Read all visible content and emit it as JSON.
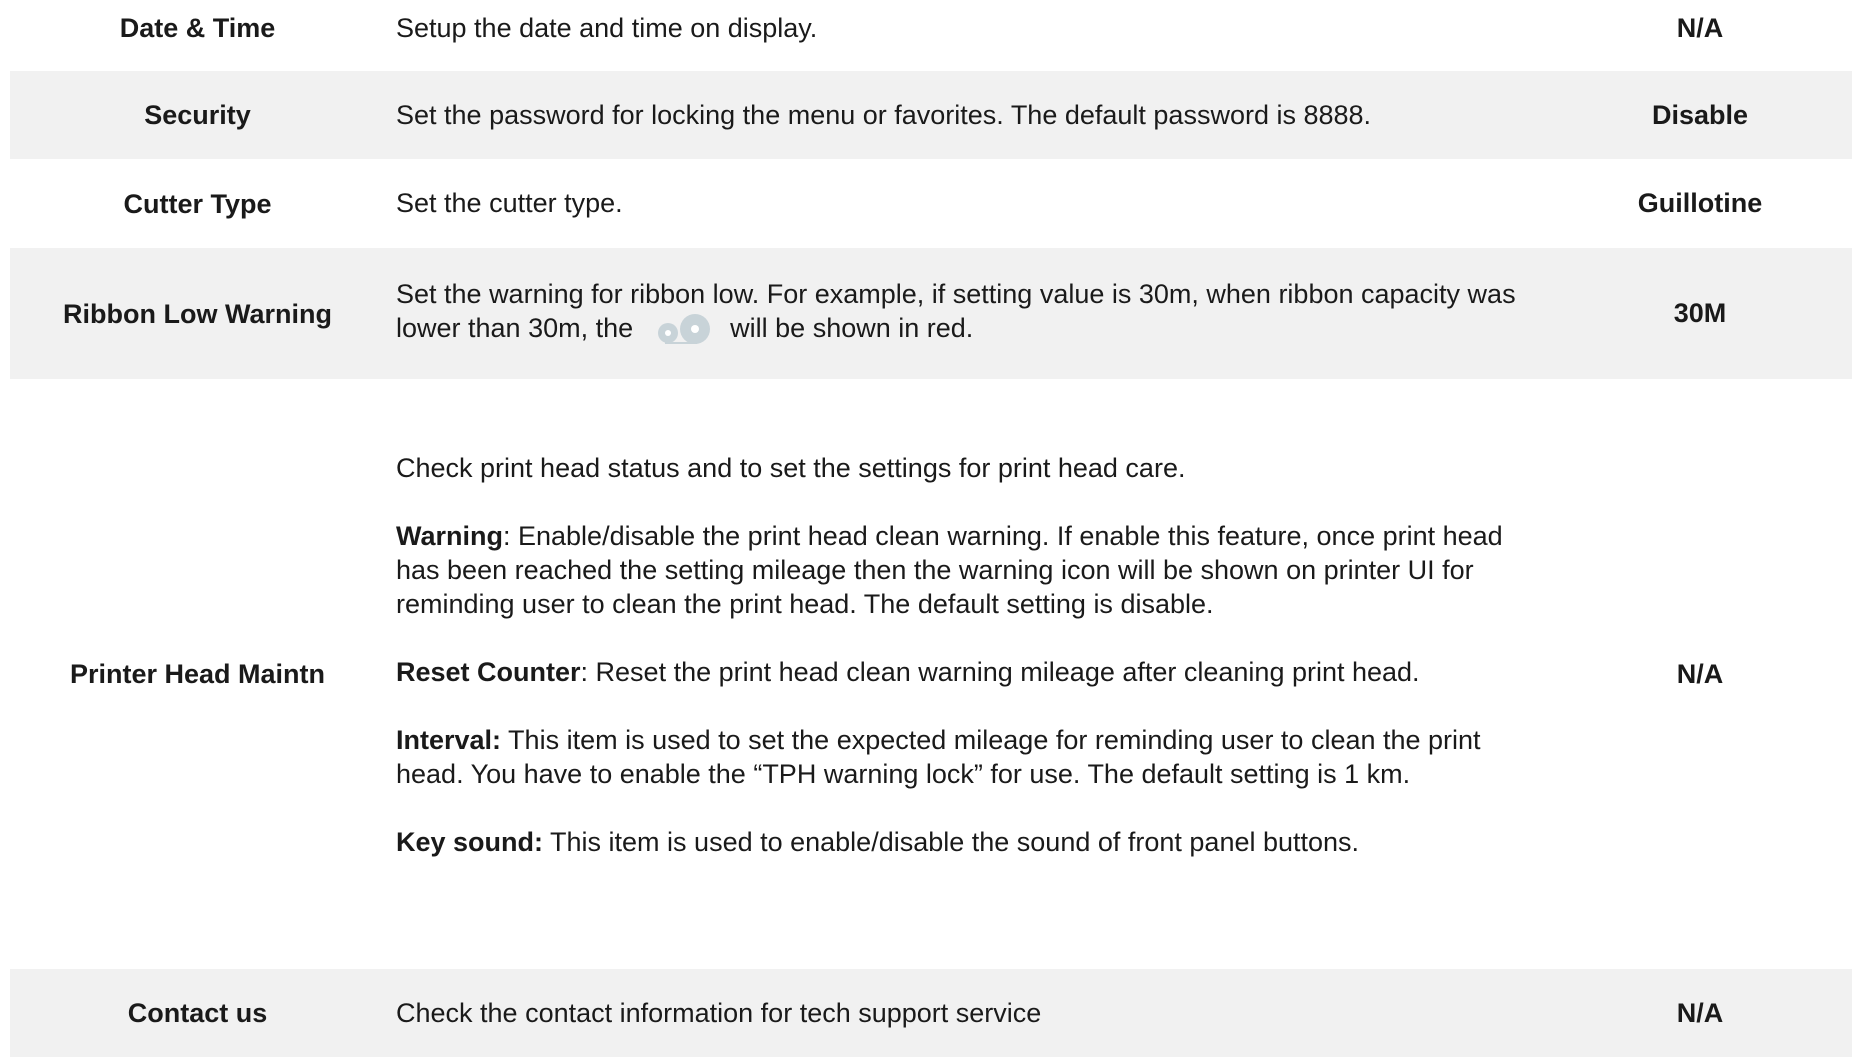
{
  "rows": [
    {
      "name": "Date & Time",
      "description": "Setup the date and time on display.",
      "value": "N/A"
    },
    {
      "name": "Security",
      "description": "Set the password for locking the menu or favorites. The default password is 8888.",
      "value": "Disable"
    },
    {
      "name": "Cutter Type",
      "description": "Set the cutter type.",
      "value": "Guillotine"
    },
    {
      "name": "Ribbon Low Warning",
      "description_before": "Set the warning for ribbon low. For example, if setting value is 30m, when ribbon capacity was lower than 30m, the",
      "icon": "ribbon-icon",
      "description_after": "will be shown in red.",
      "value": "30M"
    },
    {
      "name": "Printer Head Maintn",
      "intro": "Check print head status and to set the settings for print head care.",
      "items": [
        {
          "term": "Warning",
          "text": ": Enable/disable the print head clean warning. If enable this feature, once print head has been reached the setting mileage then the warning icon will be shown on printer UI for reminding user to clean the print head. The default setting is disable."
        },
        {
          "term": "Reset Counter",
          "text": ": Reset the print head clean warning mileage after cleaning print head."
        },
        {
          "term": "Interval:",
          "text": " This item is used to set the expected mileage for reminding user to clean the print head. You have to enable the “TPH warning lock” for use. The default setting is 1 km."
        },
        {
          "term": "Key sound:",
          "text": " This item is used to enable/disable the sound of front panel buttons."
        }
      ],
      "value": "N/A"
    },
    {
      "name": "Contact us",
      "description": "Check the contact information for tech support service",
      "value": "N/A"
    }
  ],
  "colors": {
    "shaded_row": "#f1f1f1",
    "text": "#1a1a1a",
    "icon": "#c8d3d8"
  }
}
